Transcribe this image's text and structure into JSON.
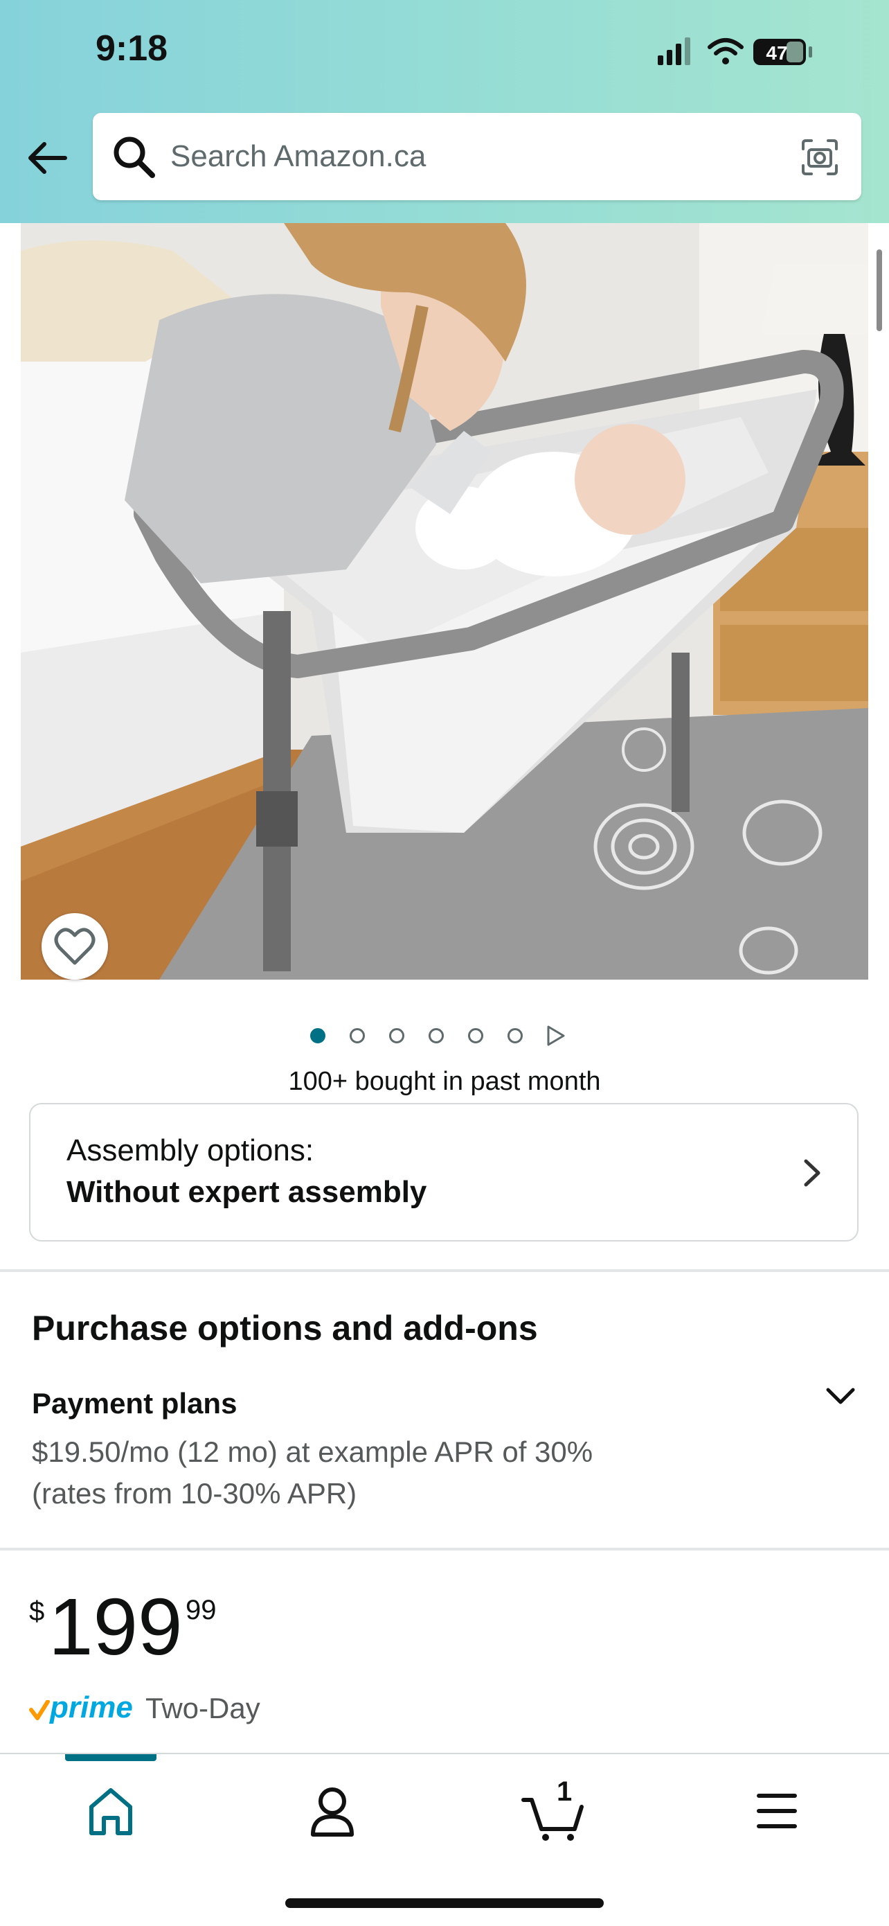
{
  "status_bar": {
    "time": "9:18",
    "battery": "47"
  },
  "search": {
    "placeholder": "Search Amazon.ca"
  },
  "product": {
    "image_alt": "Bedside bassinet with mother and baby",
    "bought_text": "100+ bought in past month",
    "carousel": {
      "total": 6,
      "active": 0
    }
  },
  "assembly": {
    "label": "Assembly options:",
    "value": "Without expert assembly"
  },
  "purchase_options": {
    "title": "Purchase options and add-ons",
    "payment_title": "Payment plans",
    "payment_line1": "$19.50/mo (12 mo) at example APR of 30%",
    "payment_line2": "(rates from 10-30% APR)"
  },
  "price": {
    "symbol": "$",
    "whole": "199",
    "fraction": "99"
  },
  "prime": {
    "brand": "prime",
    "delivery": "Two-Day"
  },
  "nav": {
    "cart_count": "1"
  },
  "colors": {
    "accent": "#007185",
    "prime": "#00a8e1",
    "prime_check": "#ff9900"
  },
  "icons": [
    "back-arrow-icon",
    "search-icon",
    "camera-icon",
    "heart-icon",
    "chevron-right-icon",
    "chevron-down-icon",
    "home-icon",
    "account-icon",
    "cart-icon",
    "menu-icon"
  ]
}
